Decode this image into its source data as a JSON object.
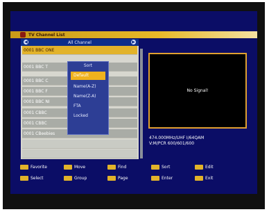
{
  "window": {
    "title": "TV Channel List"
  },
  "group": {
    "title": "All Channel"
  },
  "channels": [
    {
      "label": "0001 BBC ONE"
    },
    {
      "label": "0001 BBC T"
    },
    {
      "label": "0001 BBC C"
    },
    {
      "label": "0001 BBC F"
    },
    {
      "label": "0001 BBC NI"
    },
    {
      "label": "0001 CBBC"
    },
    {
      "label": "0001 CBBC"
    },
    {
      "label": "0001 CBeebies"
    }
  ],
  "sort_menu": {
    "title": "Sort",
    "options": [
      "Default",
      "Name(A-Z)",
      "Name(Z-A)",
      "FTA",
      "Locked"
    ]
  },
  "preview": {
    "message": "No Signal!"
  },
  "info": {
    "line1": "474.000MHz/UHF I/64QAM",
    "line2": "V:M/PCR 600/601/600"
  },
  "footer": {
    "row1": [
      "Favorite",
      "Move",
      "Find",
      "Sort",
      "Edit"
    ],
    "row2": [
      "Select",
      "Group",
      "Page",
      "Enter",
      "Exit"
    ]
  },
  "colors": {
    "accent": "#e2b32a",
    "background": "#0b0d66"
  }
}
